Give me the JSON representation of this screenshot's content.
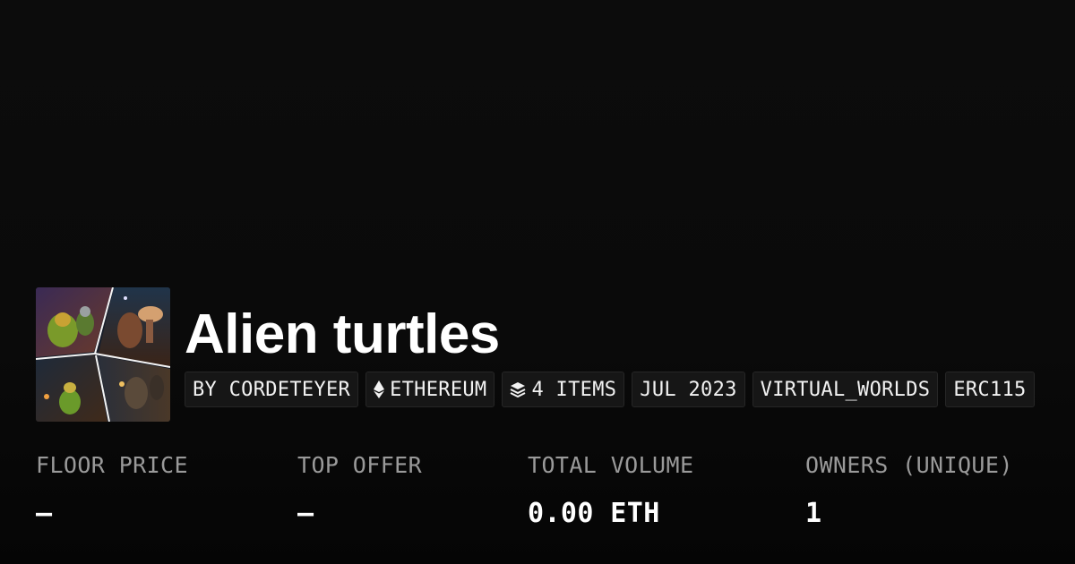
{
  "collection": {
    "title": "Alien turtles",
    "thumbnail_alt": "Alien turtles collection image",
    "tags": [
      {
        "label": "BY CORDETEYER",
        "icon": ""
      },
      {
        "label": "ETHEREUM",
        "icon": "ethereum-icon"
      },
      {
        "label": "4 ITEMS",
        "icon": "layers-icon"
      },
      {
        "label": "JUL 2023",
        "icon": ""
      },
      {
        "label": "VIRTUAL_WORLDS",
        "icon": ""
      },
      {
        "label": "ERC115",
        "icon": ""
      }
    ]
  },
  "stats": [
    {
      "label": "FLOOR PRICE",
      "value": "–"
    },
    {
      "label": "TOP OFFER",
      "value": "–"
    },
    {
      "label": "TOTAL VOLUME",
      "value": "0.00 ETH"
    },
    {
      "label": "OWNERS (UNIQUE)",
      "value": "1"
    }
  ],
  "colors": {
    "background": "#0a0a0a",
    "tag_background": "#161616",
    "label_gray": "#9a9a9a"
  }
}
